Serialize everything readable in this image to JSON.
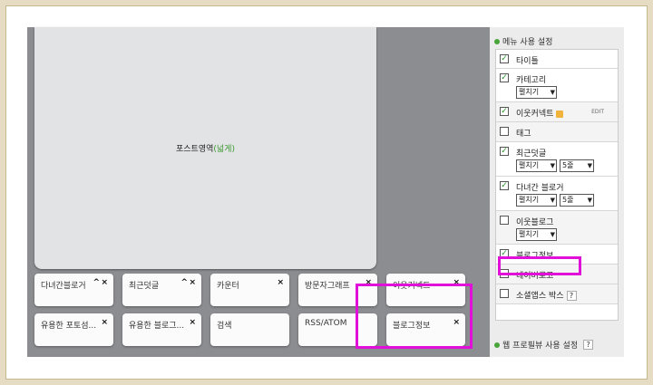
{
  "post_area": {
    "label": "포스트영역",
    "accent": "(넓게)"
  },
  "widgets": [
    {
      "label": "다녀간블로거",
      "controls": "up-close"
    },
    {
      "label": "최근덧글",
      "controls": "up-close"
    },
    {
      "label": "카운터",
      "controls": "close"
    },
    {
      "label": "방문자그래프",
      "controls": "close"
    },
    {
      "label": "이웃커넥트",
      "controls": "close"
    },
    {
      "label": "유용한 포토섬...",
      "controls": "close"
    },
    {
      "label": "유용한 블로그...",
      "controls": "close"
    },
    {
      "label": "검색",
      "controls": "none"
    },
    {
      "label": "RSS/ATOM",
      "controls": "none"
    },
    {
      "label": "블로그정보",
      "controls": "close"
    }
  ],
  "close_glyph": "×",
  "up_glyph": "^",
  "check_glyph": "✓",
  "sidebar": {
    "menu_title": "메뉴 사용 설정",
    "items": [
      {
        "label": "타이틀",
        "checked": true
      },
      {
        "label": "카테고리",
        "checked": true,
        "select1": "펼치기"
      },
      {
        "label": "이웃커넥트",
        "checked": true,
        "badge": true,
        "edit": "EDIT"
      },
      {
        "label": "태그",
        "checked": false
      },
      {
        "label": "최근덧글",
        "checked": true,
        "select1": "펼치기",
        "select2": "5줄"
      },
      {
        "label": "다녀간 블로거",
        "checked": true,
        "select1": "펼치기",
        "select2": "5줄"
      },
      {
        "label": "이웃블로그",
        "checked": false,
        "select1": "펼치기"
      },
      {
        "label": "블로그정보",
        "checked": true
      },
      {
        "label": "네이버로고",
        "checked": false
      },
      {
        "label": "소셜앱스 박스",
        "checked": false,
        "help": "?"
      }
    ],
    "profile_title": "웹 프로필뷰 사용 설정",
    "profile_help": "?"
  },
  "colors": {
    "highlight": "#e010d8",
    "accent_green": "#48a53a"
  }
}
